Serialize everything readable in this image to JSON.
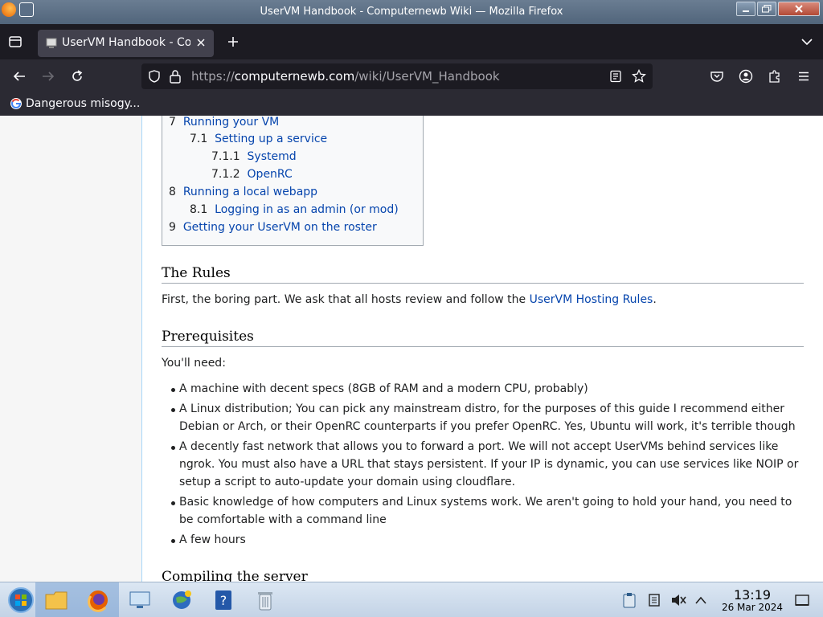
{
  "window": {
    "title": "UserVM Handbook - Computernewb Wiki — Mozilla Firefox"
  },
  "tab": {
    "label": "UserVM Handbook - Computernewb Wiki"
  },
  "urlbar": {
    "scheme": "https://",
    "domain": "computernewb.com",
    "path": "/wiki/UserVM_Handbook"
  },
  "bookmarks": [
    {
      "label": "Dangerous misogy..."
    }
  ],
  "toc": [
    {
      "num": "7",
      "text": "Running your VM",
      "level": 1
    },
    {
      "num": "7.1",
      "text": "Setting up a service",
      "level": 2
    },
    {
      "num": "7.1.1",
      "text": "Systemd",
      "level": 3
    },
    {
      "num": "7.1.2",
      "text": "OpenRC",
      "level": 3
    },
    {
      "num": "8",
      "text": "Running a local webapp",
      "level": 1
    },
    {
      "num": "8.1",
      "text": "Logging in as an admin (or mod)",
      "level": 2
    },
    {
      "num": "9",
      "text": "Getting your UserVM on the roster",
      "level": 1
    }
  ],
  "sections": {
    "rules_heading": "The Rules",
    "rules_text_before": "First, the boring part. We ask that all hosts review and follow the ",
    "rules_link": "UserVM Hosting Rules",
    "rules_text_after": ".",
    "prereq_heading": "Prerequisites",
    "prereq_intro": "You'll need:",
    "prereq_items": [
      "A machine with decent specs (8GB of RAM and a modern CPU, probably)",
      "A Linux distribution; You can pick any mainstream distro, for the purposes of this guide I recommend either Debian or Arch, or their OpenRC counterparts if you prefer OpenRC. Yes, Ubuntu will work, it's terrible though",
      "A decently fast network that allows you to forward a port. We will not accept UserVMs behind services like ngrok. You must also have a URL that stays persistent. If your IP is dynamic, you can use services like NOIP or setup a script to auto-update your domain using cloudflare.",
      "Basic knowledge of how computers and Linux systems work. We aren't going to hold your hand, you need to be comfortable with a command line",
      "A few hours"
    ],
    "compiling_heading": "Compiling the server"
  },
  "taskbar": {
    "apps": [
      "start-orb",
      "file-manager",
      "firefox",
      "system-settings",
      "kde-network-globe",
      "help",
      "trash"
    ],
    "clock_time": "13:19",
    "clock_date": "26 Mar 2024"
  },
  "colors": {
    "link": "#0645ad",
    "toolbar": "#2b2a33",
    "tabstrip": "#1c1b22"
  }
}
